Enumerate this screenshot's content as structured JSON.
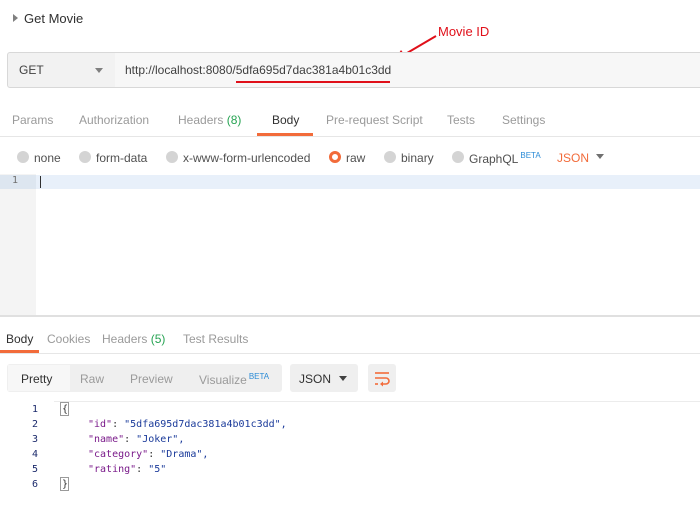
{
  "request": {
    "title": "Get Movie",
    "method": "GET",
    "url_base": "http://localhost:8080/",
    "url_id": "5dfa695d7dac381a4b01c3dd",
    "annotation": "Movie ID"
  },
  "request_tabs": [
    {
      "label": "Params"
    },
    {
      "label": "Authorization"
    },
    {
      "label": "Headers",
      "count": "(8)"
    },
    {
      "label": "Body"
    },
    {
      "label": "Pre-request Script"
    },
    {
      "label": "Tests"
    },
    {
      "label": "Settings"
    }
  ],
  "body_types": [
    "none",
    "form-data",
    "x-www-form-urlencoded",
    "raw",
    "binary",
    "GraphQL"
  ],
  "beta_label": "BETA",
  "body_format": "JSON",
  "editor_line": "1",
  "response_tabs": [
    {
      "label": "Body"
    },
    {
      "label": "Cookies"
    },
    {
      "label": "Headers",
      "count": "(5)"
    },
    {
      "label": "Test Results"
    }
  ],
  "view_modes": [
    "Pretty",
    "Raw",
    "Preview",
    "Visualize"
  ],
  "response_format": "JSON",
  "response_lines": [
    "1",
    "2",
    "3",
    "4",
    "5",
    "6"
  ],
  "response_json": {
    "open": "{",
    "close": "}",
    "fields": [
      {
        "key": "\"id\"",
        "value": "\"5dfa695d7dac381a4b01c3dd\","
      },
      {
        "key": "\"name\"",
        "value": "\"Joker\","
      },
      {
        "key": "\"category\"",
        "value": "\"Drama\","
      },
      {
        "key": "\"rating\"",
        "value": "\"5\""
      }
    ]
  },
  "colors": {
    "accent": "#f26b3a",
    "annotation": "#e0101a",
    "count": "#26a352",
    "beta": "#2b8bd6"
  }
}
